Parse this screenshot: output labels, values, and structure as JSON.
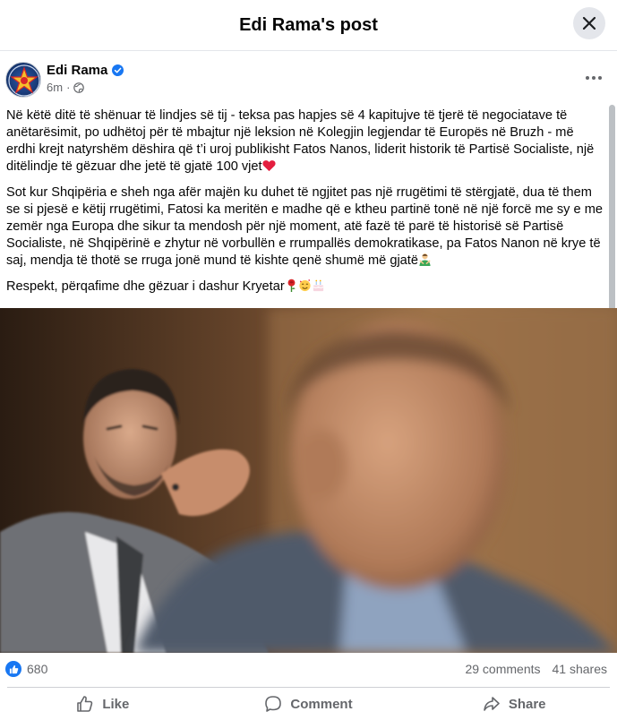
{
  "dialog": {
    "title": "Edi Rama's post"
  },
  "post": {
    "author": "Edi Rama",
    "time": "6m",
    "paragraphs": [
      "Në këtë ditë të shënuar të lindjes së tij - teksa pas hapjes së 4 kapitujve të tjerë të negociatave të anëtarësimit, po udhëtoj për të mbajtur një leksion në Kolegjin legjendar të Europës në Bruzh - më erdhi krejt natyrshëm dëshira që t’i uroj publikisht Fatos Nanos, liderit historik të Partisë Socialiste, një ditëlindje të gëzuar dhe jetë të gjatë 100 vjet",
      "Sot kur Shqipëria e sheh nga afër majën ku duhet të ngjitet pas një rrugëtimi të stërgjatë, dua të them se si pjesë e këtij rrugëtimi, Fatosi ka meritën e madhe që e ktheu partinë tonë në një forcë me sy e me zemër nga Europa dhe sikur ta mendosh për një moment, atë fazë të parë të historisë së Partisë Socialiste, në Shqipërinë e zhytur në vorbullën e rrumpallës demokratikase, pa Fatos Nanon në krye të saj, mendja të thotë se rruga jonë mund të kishte qenë shumë më gjatë",
      "Respekt, përqafime dhe gëzuar i dashur Kryetar"
    ],
    "emojis": [
      "heart",
      "man-gesturing",
      "rose",
      "smiling-face-with-hearts",
      "birthday-cake"
    ]
  },
  "stats": {
    "likes": "680",
    "comments": "29 comments",
    "shares": "41 shares"
  },
  "actions": {
    "like": "Like",
    "comment": "Comment",
    "share": "Share"
  },
  "colors": {
    "accent": "#1877f2",
    "secondary_text": "#65676b",
    "heart": "#e41e3f"
  }
}
